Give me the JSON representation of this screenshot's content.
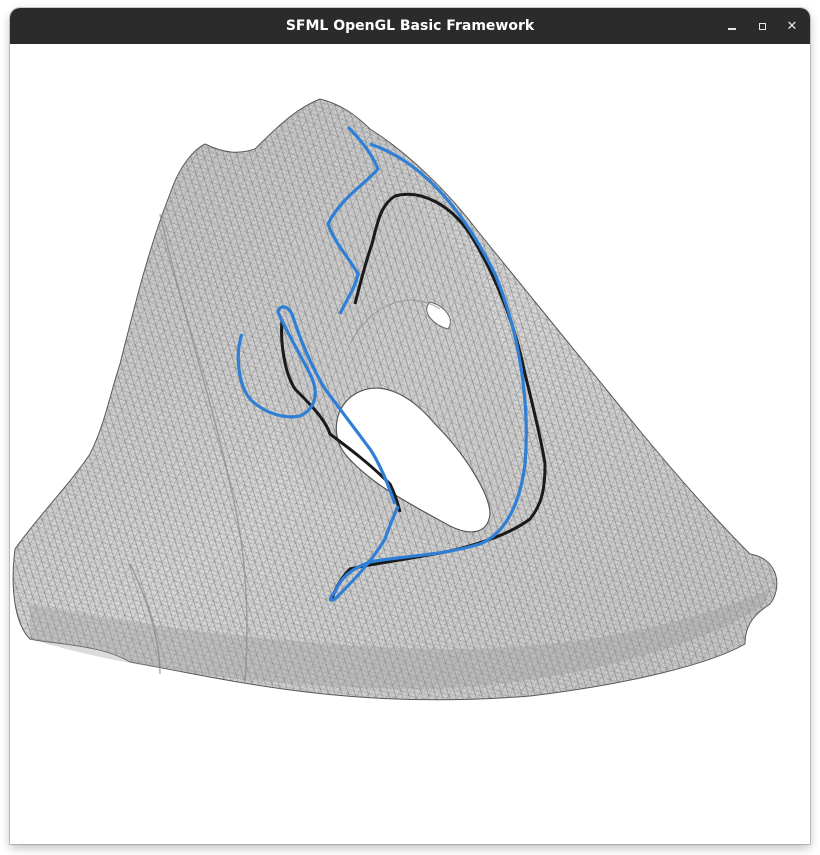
{
  "window": {
    "title": "SFML OpenGL Basic Framework",
    "controls": {
      "minimize_icon": "minimize-icon",
      "maximize_icon": "maximize-icon",
      "close_icon": "close-icon"
    }
  },
  "scene": {
    "description_icon": "mesh-render",
    "mesh_fill_color": "#d2d2d2",
    "mesh_wire_color": "#6e6e6e",
    "curve_colors": {
      "path_a": "#2f7fd6",
      "path_b": "#1a1a1a"
    },
    "background_color": "#ffffff"
  }
}
